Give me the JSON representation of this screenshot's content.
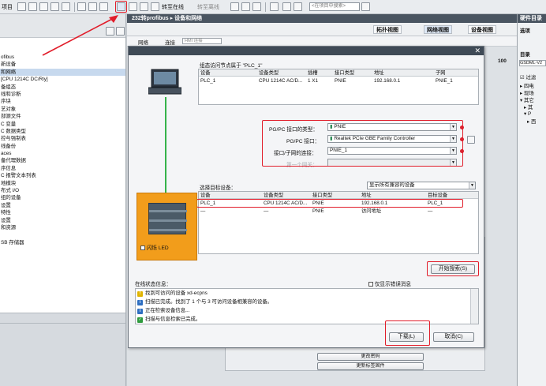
{
  "toolbar": {
    "project_label": "项目",
    "save_project": "保存项目",
    "go_online": "转至在线",
    "go_offline": "转至离线",
    "search_placeholder": "<在项目中搜索>"
  },
  "left_panel": {
    "tree_items": [
      "ofibus",
      "新设备",
      "和网络",
      "[CPU 1214C DC/Rly]",
      "备组态",
      "线和诊断",
      "序块",
      "艺对象",
      "部源文件",
      "C 变量",
      "C 数据类型",
      "控与强制表",
      "线备份",
      "aces",
      "备代理数据",
      "序信息",
      "C 报警文本列表",
      "地模块",
      "布式 I/O",
      "组的设备",
      "设置",
      "特性",
      "设置",
      "和资源",
      "",
      "SB 存储器"
    ],
    "selected_index": 2
  },
  "editor": {
    "title": "232转profibus ▸ 设备和网络",
    "tabs": {
      "topology": "拓扑视图",
      "network": "网络视图",
      "device": "设备视图"
    },
    "net_toolbar": {
      "network": "网络",
      "connections": "连接",
      "combo_value": "HMI 连接",
      "zoom": "100"
    }
  },
  "right_panel": {
    "title": "硬件目录",
    "options": "选项",
    "catalog": "目录",
    "search_value": "GSDML-V2",
    "filter": "过滤",
    "items": [
      "四电",
      "现场",
      "其它",
      "其",
      "P",
      "西"
    ]
  },
  "dialog": {
    "node_title": "组态访问节点属于 \"PLC_1\"",
    "node_table": {
      "headers": [
        "设备",
        "设备类型",
        "插槽",
        "接口类型",
        "地址",
        "子网"
      ],
      "rows": [
        [
          "PLC_1",
          "CPU 1214C AC/D...",
          "1 X1",
          "PNIE",
          "192.168.0.1",
          "PNIE_1"
        ]
      ]
    },
    "pgpc_type_label": "PG/PC 接口的类型：",
    "pgpc_type_value": "PNIE",
    "pgpc_iface_label": "PG/PC 接口：",
    "pgpc_iface_value": "Realtek PCIe GBE Family Controller",
    "subnet_label": "接口/子网的连接：",
    "subnet_value": "PNIE_1",
    "first_gateway_label": "第一个网关：",
    "target_label": "选择目标设备：",
    "target_filter": "显示所有兼容的设备",
    "target_table": {
      "headers": [
        "设备",
        "设备类型",
        "接口类型",
        "地址",
        "目标设备"
      ],
      "rows": [
        [
          "PLC_1",
          "CPU 1214C AC/D...",
          "PNIE",
          "192.168.0.1",
          "PLC_1"
        ],
        [
          "—",
          "—",
          "PNIE",
          "访问地址",
          "—"
        ]
      ]
    },
    "flash_led": "闪烁 LED",
    "start_search": "开始搜索(S)",
    "online_status_label": "在线状态信息：",
    "show_errors_only": "仅显示错误消息",
    "status_messages": [
      {
        "type": "warning",
        "text": "找到可访问的设备 xd-ecpns"
      },
      {
        "type": "info",
        "text": "扫描已完成。找到了 1 个与 3 可访问设备相兼容的设备。"
      },
      {
        "type": "info",
        "text": "正在检索设备信息..."
      },
      {
        "type": "ok",
        "text": "扫描与信息检索已完成。"
      }
    ],
    "load_button": "下载(L)",
    "cancel_button": "取消(C)"
  },
  "bottom": {
    "change_password": "更改密码",
    "update_firmware": "更新标签固件"
  },
  "colors": {
    "highlight_red": "#e11d2a",
    "device_orange": "#f29d1b",
    "title_bar": "#4a5561"
  }
}
